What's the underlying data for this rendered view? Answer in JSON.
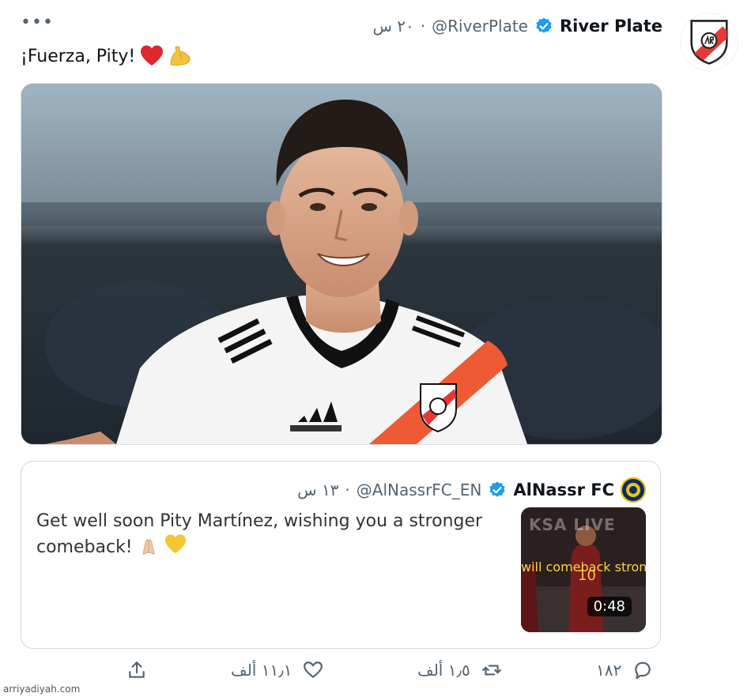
{
  "tweet": {
    "more_label": "•••",
    "author_name": "River Plate",
    "author_handle": "@RiverPlate",
    "time": "٢٠ س",
    "separator": "·",
    "text": "¡Fuerza, Pity!",
    "emojis": [
      "red-heart",
      "flexed-biceps"
    ]
  },
  "quoted": {
    "author_name": "AlNassr FC",
    "author_handle": "@AlNassrFC_EN",
    "time": "١٣ س",
    "separator": "·",
    "text": "Get well soon Pity Martínez, wishing you a stronger comeback!",
    "emojis": [
      "folded-hands",
      "yellow-heart"
    ],
    "video": {
      "overlay_top": "KSA LIVE",
      "caption": "will comeback stron",
      "duration": "0:48"
    }
  },
  "actions": {
    "replies": "١٨٢",
    "retweets": "١٫٥ ألف",
    "likes": "١١٫١ ألف"
  },
  "watermark": "arriyadiyah.com",
  "colors": {
    "verified": "#1d9bf0",
    "muted": "#536471",
    "river_red": "#e53935"
  }
}
